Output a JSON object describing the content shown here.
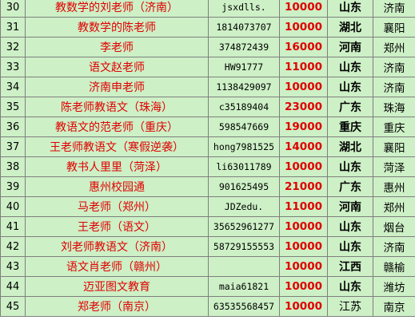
{
  "rows": [
    {
      "num": "30",
      "name": "教数学的刘老师（济南）",
      "account": "jsxdlls.",
      "amount": "10000",
      "province": "山东",
      "city": "济南",
      "bold": true
    },
    {
      "num": "31",
      "name": "教数学的陈老师",
      "account": "1814073707",
      "amount": "10000",
      "province": "湖北",
      "city": "襄阳",
      "bold": true
    },
    {
      "num": "32",
      "name": "李老师",
      "account": "374872439",
      "amount": "16000",
      "province": "河南",
      "city": "郑州",
      "bold": true
    },
    {
      "num": "33",
      "name": "语文赵老师",
      "account": "HW91777",
      "amount": "11000",
      "province": "山东",
      "city": "济南",
      "bold": true
    },
    {
      "num": "34",
      "name": "济南申老师",
      "account": "1138429097",
      "amount": "10000",
      "province": "山东",
      "city": "济南",
      "bold": true
    },
    {
      "num": "35",
      "name": "陈老师教语文（珠海）",
      "account": "c35189404",
      "amount": "23000",
      "province": "广东",
      "city": "珠海",
      "bold": true
    },
    {
      "num": "36",
      "name": "教语文的范老师（重庆）",
      "account": "598547669",
      "amount": "19000",
      "province": "重庆",
      "city": "重庆",
      "bold": true
    },
    {
      "num": "37",
      "name": "王老师教语文（寒假逆袭）",
      "account": "hong7981525",
      "amount": "14000",
      "province": "湖北",
      "city": "襄阳",
      "bold": true
    },
    {
      "num": "38",
      "name": "教书人里里（菏泽）",
      "account": "li63011789",
      "amount": "10000",
      "province": "山东",
      "city": "菏泽",
      "bold": true
    },
    {
      "num": "39",
      "name": "惠州校园通",
      "account": "901625495",
      "amount": "21000",
      "province": "广东",
      "city": "惠州",
      "bold": true
    },
    {
      "num": "40",
      "name": "马老师（郑州）",
      "account": "JDZedu.",
      "amount": "11000",
      "province": "河南",
      "city": "郑州",
      "bold": true
    },
    {
      "num": "41",
      "name": "王老师（语文）",
      "account": "35652961277",
      "amount": "10000",
      "province": "山东",
      "city": "烟台",
      "bold": true
    },
    {
      "num": "42",
      "name": "刘老师教语文（济南）",
      "account": "58729155553",
      "amount": "10000",
      "province": "山东",
      "city": "济南",
      "bold": true
    },
    {
      "num": "43",
      "name": "语文肖老师（赣州）",
      "account": "",
      "amount": "10000",
      "province": "江西",
      "city": "赣榆",
      "bold": true
    },
    {
      "num": "44",
      "name": "迈亚图文教育",
      "account": "maia61821",
      "amount": "10000",
      "province": "山东",
      "city": "潍坊",
      "bold": true
    },
    {
      "num": "45",
      "name": "郑老师（南京）",
      "account": "63535568457",
      "amount": "10000",
      "province": "江苏",
      "city": "南京",
      "bold": false
    }
  ]
}
